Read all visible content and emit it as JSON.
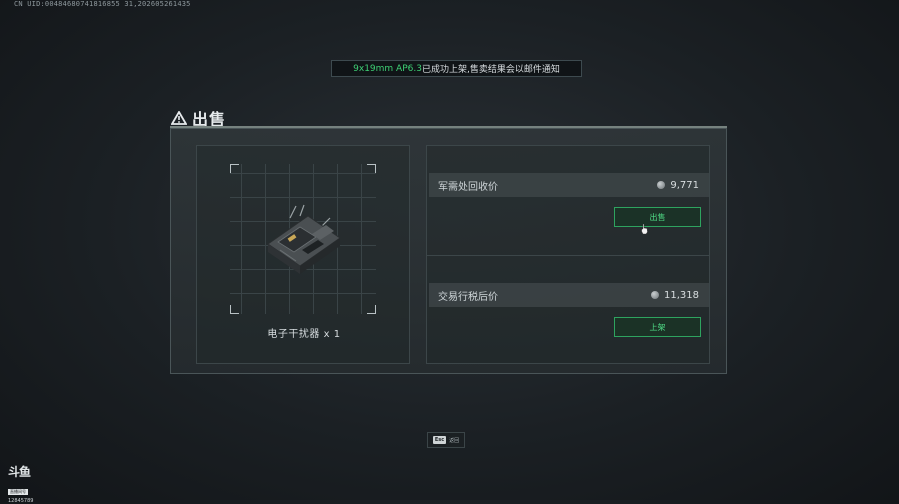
{
  "header": {
    "uid_text": "CN UID:00484680741816855 31,202605261435"
  },
  "toast": {
    "item": "9x19mm AP6.3",
    "message": "已成功上架,售卖结果会以邮件通知"
  },
  "dialog": {
    "title": "出售",
    "item_name": "电子干扰器 x 1",
    "recycle": {
      "label": "军需处回收价",
      "value": "9,771",
      "button": "出售"
    },
    "market": {
      "label": "交易行税后价",
      "value": "11,318",
      "button": "上架"
    }
  },
  "footer": {
    "esc_key": "Esc",
    "esc_label": "返回"
  },
  "watermark": {
    "mark": "斗鱼",
    "tag": "直播间号",
    "room": "12845789"
  },
  "colors": {
    "accent_green": "#3ecf74",
    "button_border": "#2ea35f"
  },
  "icons": {
    "title": "warning-triangle-icon",
    "price": "coin-icon",
    "cursor": "cursor-hand-icon"
  }
}
